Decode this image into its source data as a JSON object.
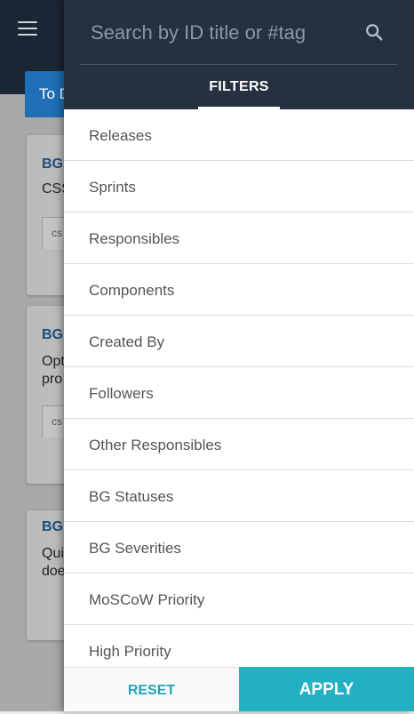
{
  "background": {
    "tab_label": "To D",
    "cards": [
      {
        "tag": "BG",
        "title": "CSS",
        "chip": "cs"
      },
      {
        "tag": "BG",
        "title_line1": "Opt",
        "title_line2": "pro",
        "chip": "cs"
      },
      {
        "tag": "BG",
        "title_line1": "Qui",
        "title_line2": "doe"
      }
    ]
  },
  "search": {
    "placeholder": "Search by ID title or #tag",
    "value": ""
  },
  "tabs": {
    "filters_label": "FILTERS"
  },
  "filters": [
    "Releases",
    "Sprints",
    "Responsibles",
    "Components",
    "Created By",
    "Followers",
    "Other Responsibles",
    "BG Statuses",
    "BG Severities",
    "MoSCoW Priority",
    "High Priority"
  ],
  "footer": {
    "reset_label": "RESET",
    "apply_label": "APPLY"
  },
  "colors": {
    "header": "#253040",
    "accent": "#22b1c2"
  }
}
